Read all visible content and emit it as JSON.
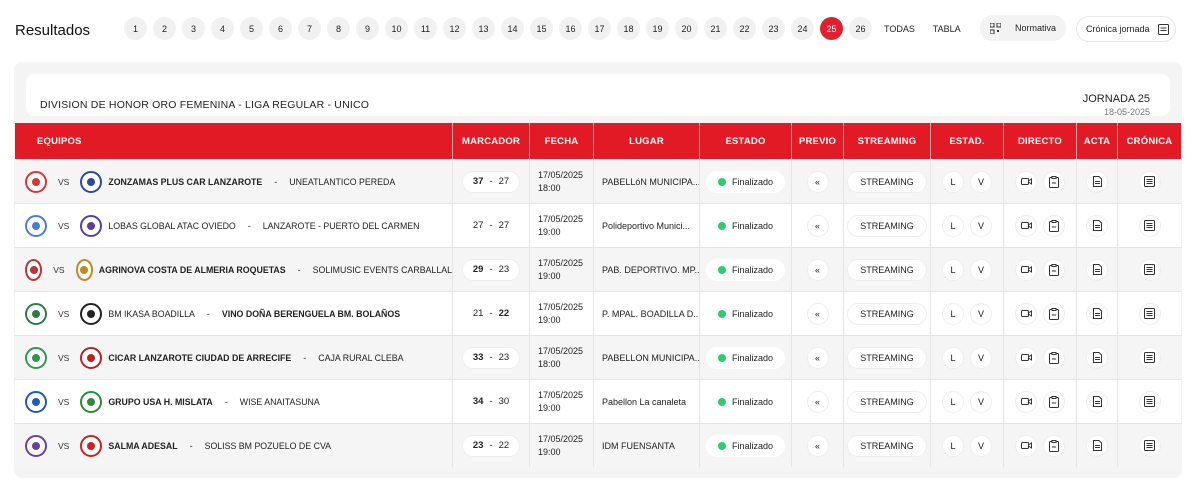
{
  "header": {
    "title": "Resultados",
    "pages": [
      "1",
      "2",
      "3",
      "4",
      "5",
      "6",
      "7",
      "8",
      "9",
      "10",
      "11",
      "12",
      "13",
      "14",
      "15",
      "16",
      "17",
      "18",
      "19",
      "20",
      "21",
      "22",
      "23",
      "24",
      "25",
      "26"
    ],
    "active_page": "25",
    "todas": "TODAS",
    "tabla": "TABLA",
    "normativa": "Normativa",
    "cronica": "Crónica jornada"
  },
  "competition": {
    "name": "DIVISION DE HONOR ORO FEMENINA - LIGA REGULAR - UNICO",
    "jornada": "JORNADA 25",
    "date": "18-05-2025"
  },
  "columns": {
    "equipos": "EQUIPOS",
    "marcador": "MARCADOR",
    "fecha": "FECHA",
    "lugar": "LUGAR",
    "estado": "ESTADO",
    "previo": "PREVIO",
    "streaming": "STREAMING",
    "estad": "ESTAD.",
    "directo": "DIRECTO",
    "acta": "ACTA",
    "cronica": "CRÓNICA"
  },
  "labels": {
    "vs": "VS",
    "dash": "-",
    "prev": "«",
    "streaming": "STREAMING",
    "l": "L",
    "v": "V"
  },
  "colors": {
    "accent": "#e0212d",
    "status_dot": "#2ecc71"
  },
  "matches": [
    {
      "home": "ZONZAMAS PLUS CAR LANZAROTE",
      "away": "UNEATLANTICO PEREDA",
      "winner": "home",
      "home_score": "37",
      "away_score": "27",
      "date": "17/05/2025",
      "time": "18:00",
      "venue": "PABELLóN MUNICIPA...",
      "status": "Finalizado"
    },
    {
      "home": "LOBAS GLOBAL ATAC OVIEDO",
      "away": "LANZAROTE - PUERTO DEL CARMEN",
      "winner": "none",
      "home_score": "27",
      "away_score": "27",
      "date": "17/05/2025",
      "time": "19:00",
      "venue": "Polideportivo Munici...",
      "status": "Finalizado"
    },
    {
      "home": "AGRINOVA COSTA DE ALMERIA ROQUETAS",
      "away": "SOLIMUSIC EVENTS CARBALLAL",
      "winner": "home",
      "home_score": "29",
      "away_score": "23",
      "date": "17/05/2025",
      "time": "19:00",
      "venue": "PAB. DEPORTIVO. MP...",
      "status": "Finalizado"
    },
    {
      "home": "BM IKASA BOADILLA",
      "away": "VINO DOÑA BERENGUELA BM. BOLAÑOS",
      "winner": "away",
      "home_score": "21",
      "away_score": "22",
      "date": "17/05/2025",
      "time": "19:00",
      "venue": "P. MPAL. BOADILLA D...",
      "status": "Finalizado"
    },
    {
      "home": "CICAR LANZAROTE CIUDAD DE ARRECIFE",
      "away": "CAJA RURAL CLEBA",
      "winner": "home",
      "home_score": "33",
      "away_score": "23",
      "date": "17/05/2025",
      "time": "18:00",
      "venue": "PABELLON MUNICIPA...",
      "status": "Finalizado"
    },
    {
      "home": "GRUPO USA H. MISLATA",
      "away": "WISE ANAITASUNA",
      "winner": "home",
      "home_score": "34",
      "away_score": "30",
      "date": "17/05/2025",
      "time": "19:00",
      "venue": "Pabellon La canaleta",
      "status": "Finalizado"
    },
    {
      "home": "SALMA ADESAL",
      "away": "SOLISS BM POZUELO DE CVA",
      "winner": "home",
      "home_score": "23",
      "away_score": "22",
      "date": "17/05/2025",
      "time": "19:00",
      "venue": "IDM FUENSANTA",
      "status": "Finalizado"
    }
  ]
}
